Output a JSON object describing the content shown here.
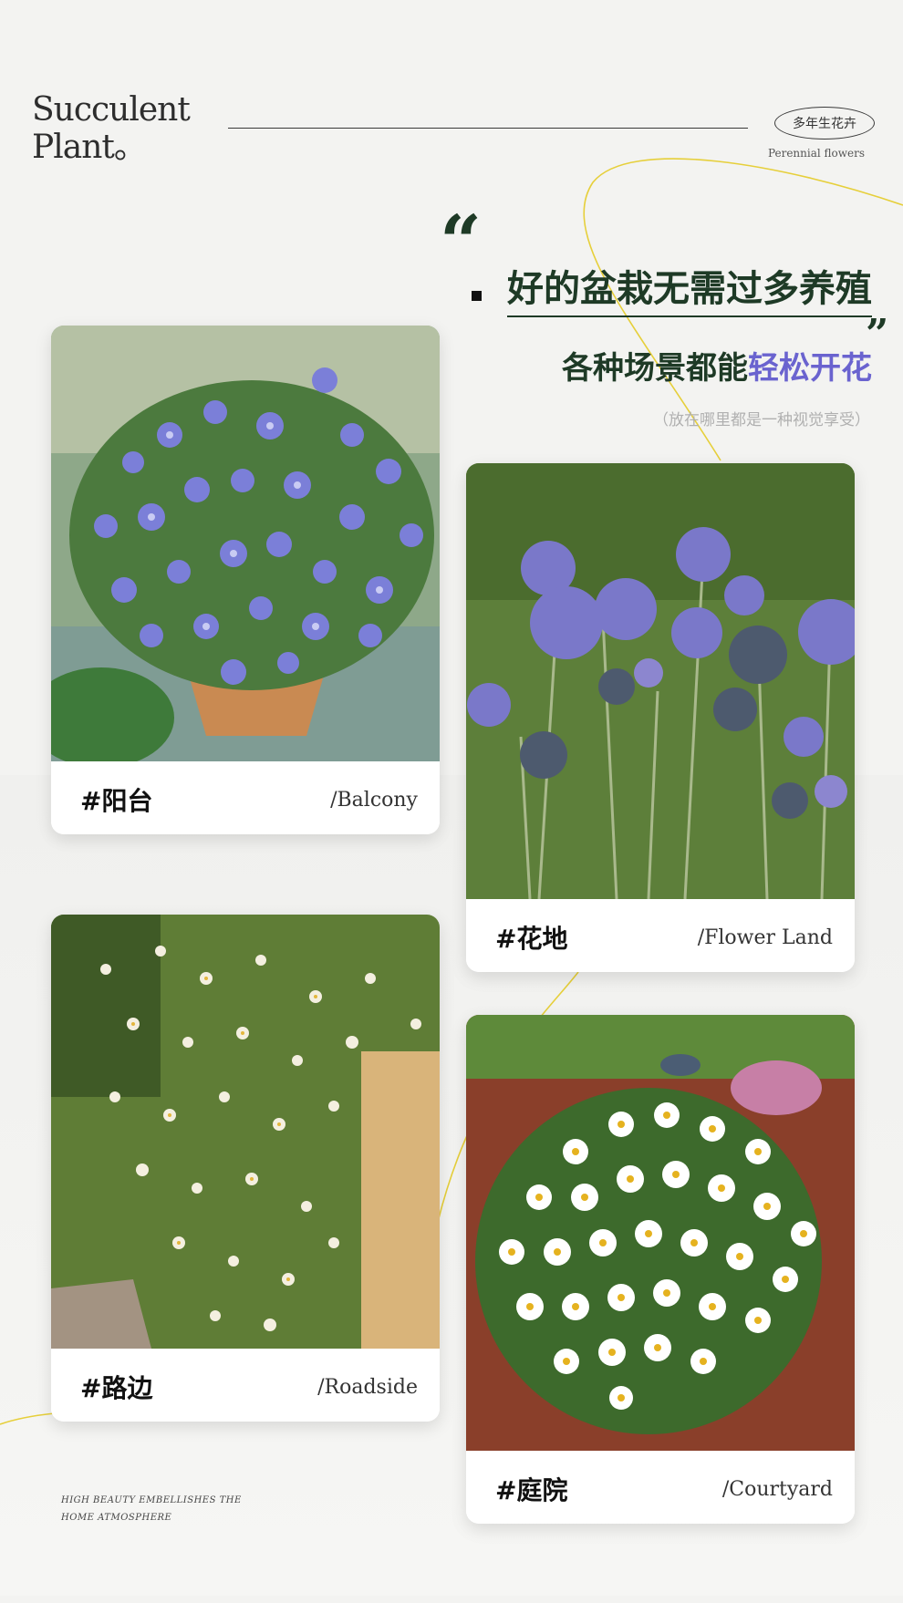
{
  "header": {
    "brand_line1": "Succulent",
    "brand_line2": "Plant。",
    "badge": "多年生花卉",
    "badge_sub": "Perennial flowers"
  },
  "headline": {
    "line1": "好的盆栽无需过多养殖",
    "line2_prefix": "各种场景都能",
    "line2_highlight": "轻松开花",
    "subnote": "（放在哪里都是一种视觉享受）"
  },
  "cards": [
    {
      "tag_zh": "#阳台",
      "tag_en": "/Balcony"
    },
    {
      "tag_zh": "#花地",
      "tag_en": "/Flower Land"
    },
    {
      "tag_zh": "#路边",
      "tag_en": "/Roadside"
    },
    {
      "tag_zh": "#庭院",
      "tag_en": "/Courtyard"
    }
  ],
  "footer": {
    "line1": "HIGH BEAUTY EMBELLISHES THE",
    "line2": "HOME ATMOSPHERE"
  },
  "colors": {
    "accent_green": "#1e3a26",
    "accent_purple": "#6a63cf",
    "deco_line": "#e6cf3a"
  }
}
